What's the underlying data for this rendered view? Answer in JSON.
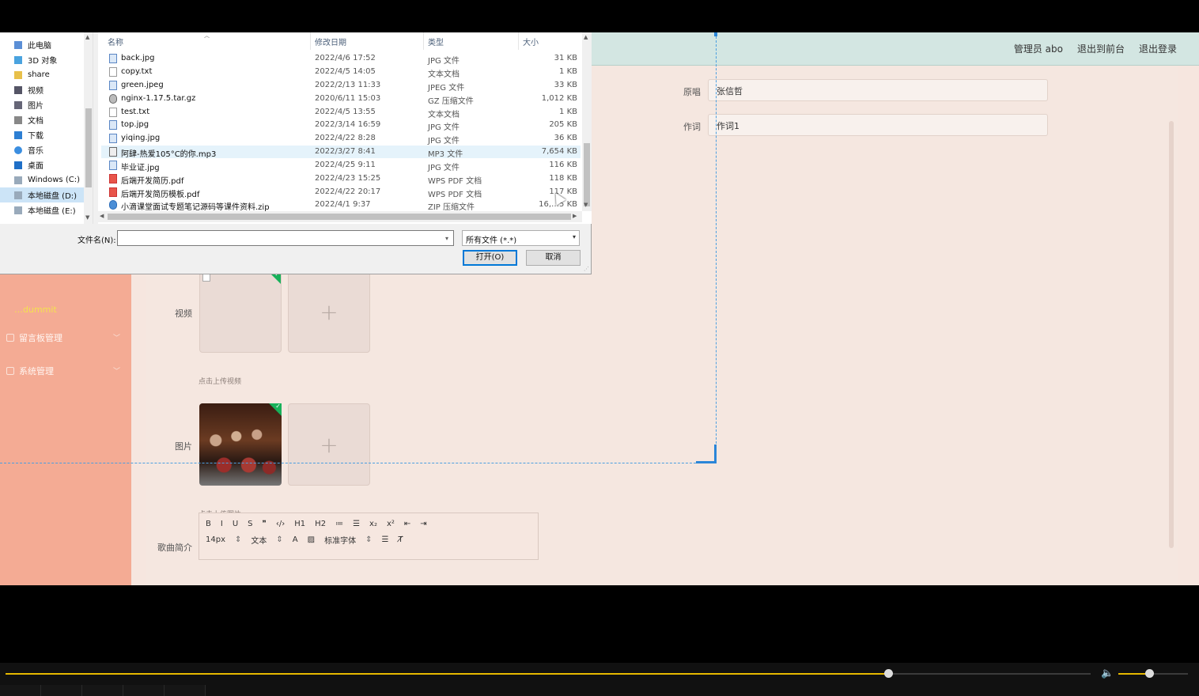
{
  "header": {
    "admin_label": "管理员 abo",
    "back_frontend": "退出到前台",
    "logout": "退出登录"
  },
  "sidebar": {
    "yellow_label": "…dummit",
    "items": [
      {
        "label": "留言板管理",
        "icon": "message-icon"
      },
      {
        "label": "系统管理",
        "icon": "settings-icon"
      }
    ]
  },
  "form": {
    "singer_label": "原唱",
    "singer_value": "张信哲",
    "lyricist_label": "作词",
    "lyricist_value": "作词1",
    "video_label": "视频",
    "video_hint": "点击上传视频",
    "image_label": "图片",
    "image_hint": "点击上传图片",
    "intro_label": "歌曲简介",
    "editor": {
      "row1": [
        "B",
        "I",
        "U",
        "S",
        "❞",
        "‹/›",
        "H1",
        "H2",
        "≔",
        "☰",
        "x₂",
        "x²",
        "⇤",
        "⇥"
      ],
      "font_size": "14px",
      "block_type": "文本",
      "font_family": "标准字体"
    }
  },
  "dialog": {
    "nav_items": [
      {
        "label": "此电脑",
        "icon": "computer-icon",
        "selected": false
      },
      {
        "label": "3D 对象",
        "icon": "3d-objects-icon",
        "selected": false
      },
      {
        "label": "share",
        "icon": "user-folder-icon",
        "selected": false
      },
      {
        "label": "视频",
        "icon": "video-folder-icon",
        "selected": false
      },
      {
        "label": "图片",
        "icon": "pictures-folder-icon",
        "selected": false
      },
      {
        "label": "文档",
        "icon": "documents-folder-icon",
        "selected": false
      },
      {
        "label": "下载",
        "icon": "downloads-folder-icon",
        "selected": false
      },
      {
        "label": "音乐",
        "icon": "music-folder-icon",
        "selected": false
      },
      {
        "label": "桌面",
        "icon": "desktop-folder-icon",
        "selected": false
      },
      {
        "label": "Windows (C:)",
        "icon": "drive-c-icon",
        "selected": false
      },
      {
        "label": "本地磁盘 (D:)",
        "icon": "drive-d-icon",
        "selected": true
      },
      {
        "label": "本地磁盘 (E:)",
        "icon": "drive-e-icon",
        "selected": false
      }
    ],
    "columns": {
      "name": "名称",
      "date": "修改日期",
      "type": "类型",
      "size": "大小"
    },
    "files": [
      {
        "name": "back.jpg",
        "date": "2022/4/6 17:52",
        "type": "JPG 文件",
        "size": "31 KB",
        "icon": "img"
      },
      {
        "name": "copy.txt",
        "date": "2022/4/5 14:05",
        "type": "文本文档",
        "size": "1 KB",
        "icon": "txt"
      },
      {
        "name": "green.jpeg",
        "date": "2022/2/13 11:33",
        "type": "JPEG 文件",
        "size": "33 KB",
        "icon": "img"
      },
      {
        "name": "nginx-1.17.5.tar.gz",
        "date": "2020/6/11 15:03",
        "type": "GZ 压缩文件",
        "size": "1,012 KB",
        "icon": "gz"
      },
      {
        "name": "test.txt",
        "date": "2022/4/5 13:55",
        "type": "文本文档",
        "size": "1 KB",
        "icon": "txt"
      },
      {
        "name": "top.jpg",
        "date": "2022/3/14 16:59",
        "type": "JPG 文件",
        "size": "205 KB",
        "icon": "img"
      },
      {
        "name": "yiqing.jpg",
        "date": "2022/4/22 8:28",
        "type": "JPG 文件",
        "size": "36 KB",
        "icon": "img"
      },
      {
        "name": "阿肆-热爱105°C的你.mp3",
        "date": "2022/3/27 8:41",
        "type": "MP3 文件",
        "size": "7,654 KB",
        "icon": "mp3"
      },
      {
        "name": "毕业证.jpg",
        "date": "2022/4/25 9:11",
        "type": "JPG 文件",
        "size": "116 KB",
        "icon": "img"
      },
      {
        "name": "后端开发简历.pdf",
        "date": "2022/4/23 15:25",
        "type": "WPS PDF 文档",
        "size": "118 KB",
        "icon": "pdf"
      },
      {
        "name": "后端开发简历模板.pdf",
        "date": "2022/4/22 20:17",
        "type": "WPS PDF 文档",
        "size": "117 KB",
        "icon": "pdf"
      },
      {
        "name": "小滴课堂面试专题笔记源码等课件资料.zip",
        "date": "2022/4/1 9:37",
        "type": "ZIP 压缩文件",
        "size": "16,…5 KB",
        "icon": "zip"
      }
    ],
    "filename_label": "文件名(N):",
    "filename_value": "",
    "file_type": "所有文件 (*.*)",
    "open_button": "打开(O)",
    "cancel_button": "取消"
  },
  "player": {
    "progress": 0.74,
    "volume": 0.45
  }
}
